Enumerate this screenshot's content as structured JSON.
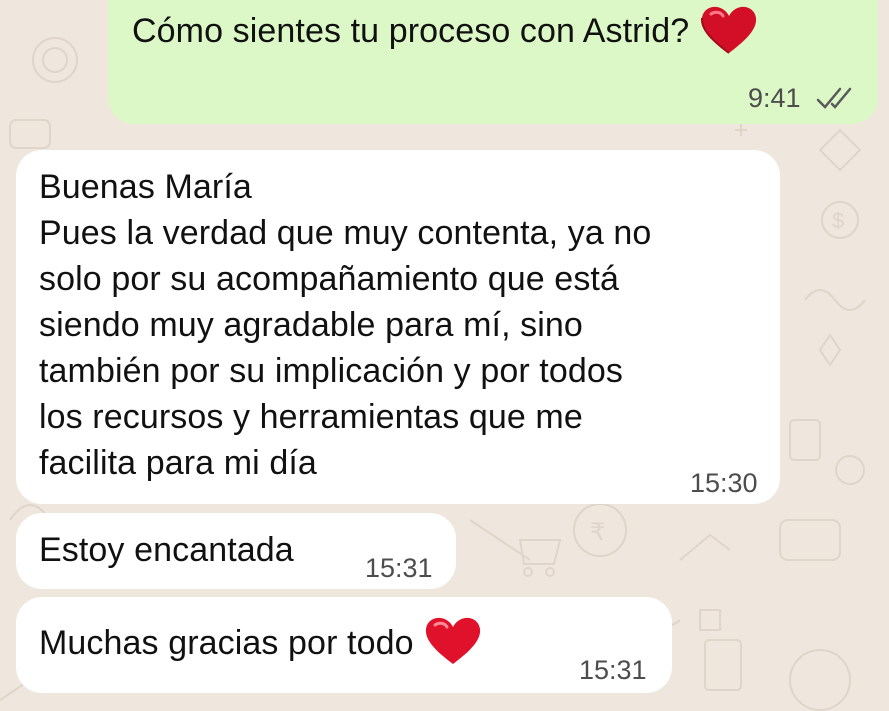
{
  "messages": [
    {
      "direction": "outgoing",
      "text": "Cómo sientes tu proceso con Astrid?",
      "emoji": "heart-emoji",
      "time": "9:41",
      "status": "read"
    },
    {
      "direction": "incoming",
      "lines": [
        "Buenas María",
        "Pues la verdad que muy contenta, ya no",
        "solo por su acompañamiento que está",
        "siendo muy agradable para mí, sino",
        "también por su implicación y por todos",
        "los recursos y herramientas que me",
        "facilita para mi día"
      ],
      "time": "15:30"
    },
    {
      "direction": "incoming",
      "text": "Estoy encantada",
      "time": "15:31"
    },
    {
      "direction": "incoming",
      "text": "Muchas gracias por todo",
      "emoji": "heart-emoji",
      "time": "15:31"
    }
  ],
  "colors": {
    "outgoing_bubble": "#dcf8c6",
    "incoming_bubble": "#ffffff",
    "wallpaper": "#efe7dd",
    "read_ticks": "#53bdeb",
    "heart": "#e0112b"
  }
}
